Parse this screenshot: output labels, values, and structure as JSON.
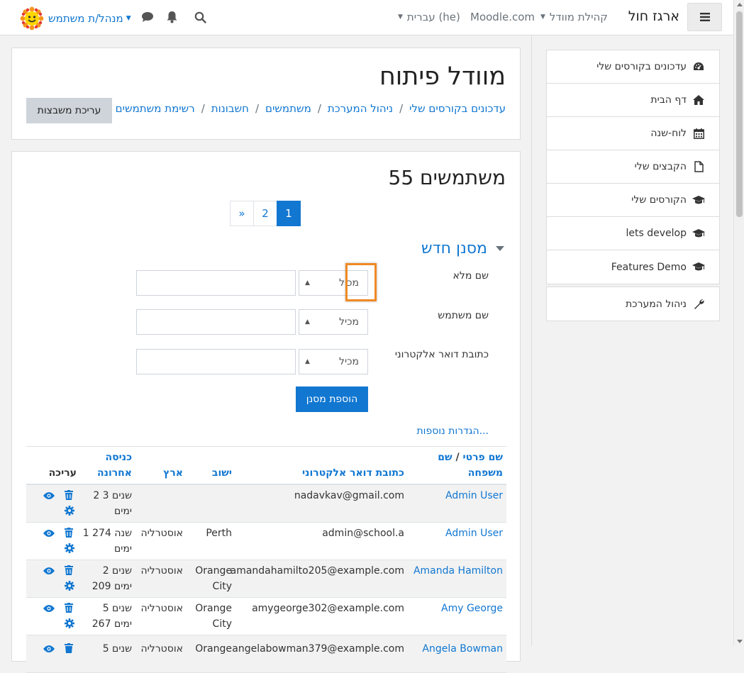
{
  "navbar": {
    "brand": "ארגז חול",
    "links": {
      "community": "קהילת מוודל",
      "moodle_com": "Moodle.com",
      "language": "עברית (he)"
    },
    "user_menu": "מנהל/ת משתמש"
  },
  "header": {
    "title": "מוודל פיתוח",
    "breadcrumb": [
      "עדכונים בקורסים שלי",
      "ניהול המערכת",
      "משתמשים",
      "חשבונות",
      "רשימת משתמשים"
    ],
    "edit_button": "עריכת משבצות"
  },
  "users": {
    "count_title": "55 משתמשים",
    "pagination": [
      "1",
      "2",
      "»"
    ],
    "filter_title": "מסנן חדש",
    "filters": [
      {
        "label": "שם מלא",
        "select": "מכיל"
      },
      {
        "label": "שם משתמש",
        "select": "מכיל"
      },
      {
        "label": "כתובת דואר אלקטרוני",
        "select": "מכיל"
      }
    ],
    "add_filter": "הוספת מסנן",
    "more_settings": "הגדרות נוספות...",
    "columns": {
      "first": "שם פרטי",
      "slash": "/",
      "last": "שם",
      "last2": "משפחה",
      "email": "כתובת דואר אלקטרוני",
      "city": "ישוב",
      "country": "ארץ",
      "access1": "כניסה",
      "access2": "אחרונה",
      "edit": "עריכה"
    },
    "rows": [
      {
        "name": "Admin User",
        "email": "nadavkav@gmail.com",
        "city": "",
        "country": "",
        "access1": "2 שנים 3",
        "access2": "ימים"
      },
      {
        "name": "Admin User",
        "email": "admin@school.a",
        "city": "Perth",
        "country": "אוסטרליה",
        "access1": "1 שנה 274",
        "access2": "ימים"
      },
      {
        "name": "Amanda Hamilton",
        "email": "amandahamilto205@example.com",
        "city": "Orange",
        "city2": "City",
        "country": "אוסטרליה",
        "access1": "2 שנים",
        "access2": "209 ימים"
      },
      {
        "name": "Amy George",
        "email": "amygeorge302@example.com",
        "city": "Orange",
        "city2": "City",
        "country": "אוסטרליה",
        "access1": "5 שנים",
        "access2": "267 ימים"
      },
      {
        "name": "Angela Bowman",
        "email": "angelabowman379@example.com",
        "city": "Orange",
        "country": "אוסטרליה",
        "access1": "5 שנים",
        "access2": ""
      }
    ]
  },
  "sidebar": {
    "items": [
      {
        "label": "עדכונים בקורסים שלי",
        "icon": "dashboard-icon"
      },
      {
        "label": "דף הבית",
        "icon": "home-icon"
      },
      {
        "label": "לוח-שנה",
        "icon": "calendar-icon"
      },
      {
        "label": "הקבצים שלי",
        "icon": "file-icon"
      },
      {
        "label": "הקורסים שלי",
        "icon": "graduation-cap-icon"
      },
      {
        "label": "lets develop",
        "icon": "graduation-cap-icon"
      },
      {
        "label": "Features Demo",
        "icon": "graduation-cap-icon"
      }
    ],
    "admin": {
      "label": "ניהול המערכת",
      "icon": "wrench-icon"
    }
  }
}
